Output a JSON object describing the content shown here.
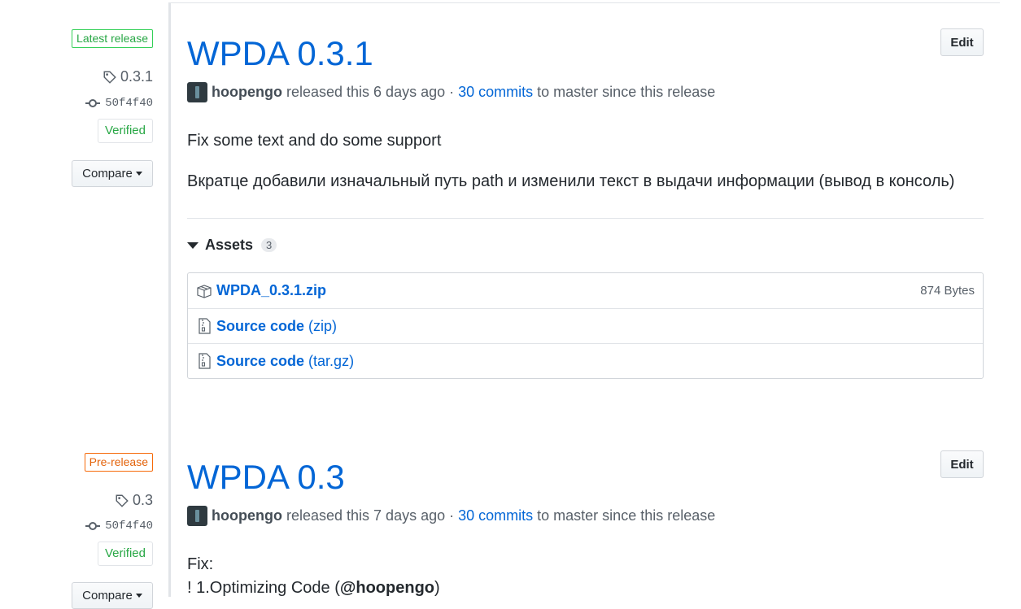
{
  "releases": [
    {
      "badge": "Latest release",
      "tag": "0.3.1",
      "commit": "50f4f40",
      "verified": "Verified",
      "compare": "Compare",
      "title": "WPDA 0.3.1",
      "edit": "Edit",
      "author": "hoopengo",
      "released": "released this 6 days ago",
      "sep": "·",
      "commits": "30 commits",
      "since": "to master since this release",
      "body": [
        "Fix some text and do some support",
        "Вкратце добавили изначальный путь path и изменили текст в выдачи информации (вывод в консоль)"
      ],
      "assets_label": "Assets",
      "assets_count": "3",
      "assets": [
        {
          "icon": "package-icon",
          "name": "WPDA_0.3.1.zip",
          "format": "",
          "size": "874 Bytes"
        },
        {
          "icon": "file-zip-icon",
          "name": "Source code",
          "format": "(zip)",
          "size": ""
        },
        {
          "icon": "file-zip-icon",
          "name": "Source code",
          "format": "(tar.gz)",
          "size": ""
        }
      ]
    },
    {
      "badge": "Pre-release",
      "tag": "0.3",
      "commit": "50f4f40",
      "verified": "Verified",
      "compare": "Compare",
      "title": "WPDA 0.3",
      "edit": "Edit",
      "author": "hoopengo",
      "released": "released this 7 days ago",
      "sep": "·",
      "commits": "30 commits",
      "since": "to master since this release",
      "body": [
        "Fix:",
        "! 1.Optimizing Code (",
        "@hoopengo",
        ")"
      ]
    }
  ],
  "colors": {
    "link": "#0366d6",
    "latest": "#28a745",
    "pre": "#e36209"
  }
}
